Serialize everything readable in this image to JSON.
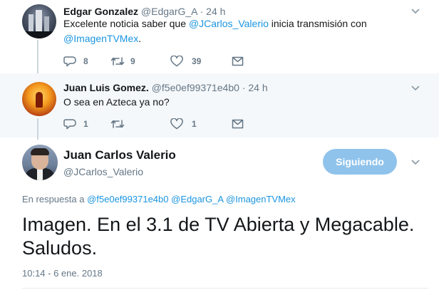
{
  "tweets": [
    {
      "name": "Edgar Gonzalez",
      "handle": "@EdgarG_A",
      "time": "· 24 h",
      "text_parts": [
        "Excelente noticia saber que ",
        "@JCarlos_Valerio",
        " inicia transmisión con",
        "@ImagenTVMex",
        "."
      ],
      "replies": "8",
      "retweets": "9",
      "likes": "39"
    },
    {
      "name": "Juan Luis Gomez.",
      "handle": "@f5e0ef99371e4b0",
      "time": "· 24 h",
      "text": "O sea en Azteca ya no?",
      "replies": "1",
      "retweets": "",
      "likes": "1"
    }
  ],
  "main_tweet": {
    "name": "Juan Carlos Valerio",
    "handle": "@JCarlos_Valerio",
    "follow_label": "Siguiendo",
    "reply_prefix": "En respuesta a",
    "reply_handles": [
      "@f5e0ef99371e4b0",
      "@EdgarG_A",
      "@ImagenTVMex"
    ],
    "text": "Imagen. En el 3.1 de TV Abierta y Megacable. Saludos.",
    "timestamp": "10:14 - 6 ene. 2018"
  },
  "icons": {
    "reply": "speech-bubble-icon",
    "retweet": "retweet-icon",
    "like": "heart-icon",
    "dm": "envelope-icon",
    "menu": "chevron-down-icon"
  },
  "colors": {
    "link": "#1b95e0",
    "follow_button": "#8fc3ec",
    "muted": "#657786",
    "reply_bg": "#f5f8fa"
  }
}
